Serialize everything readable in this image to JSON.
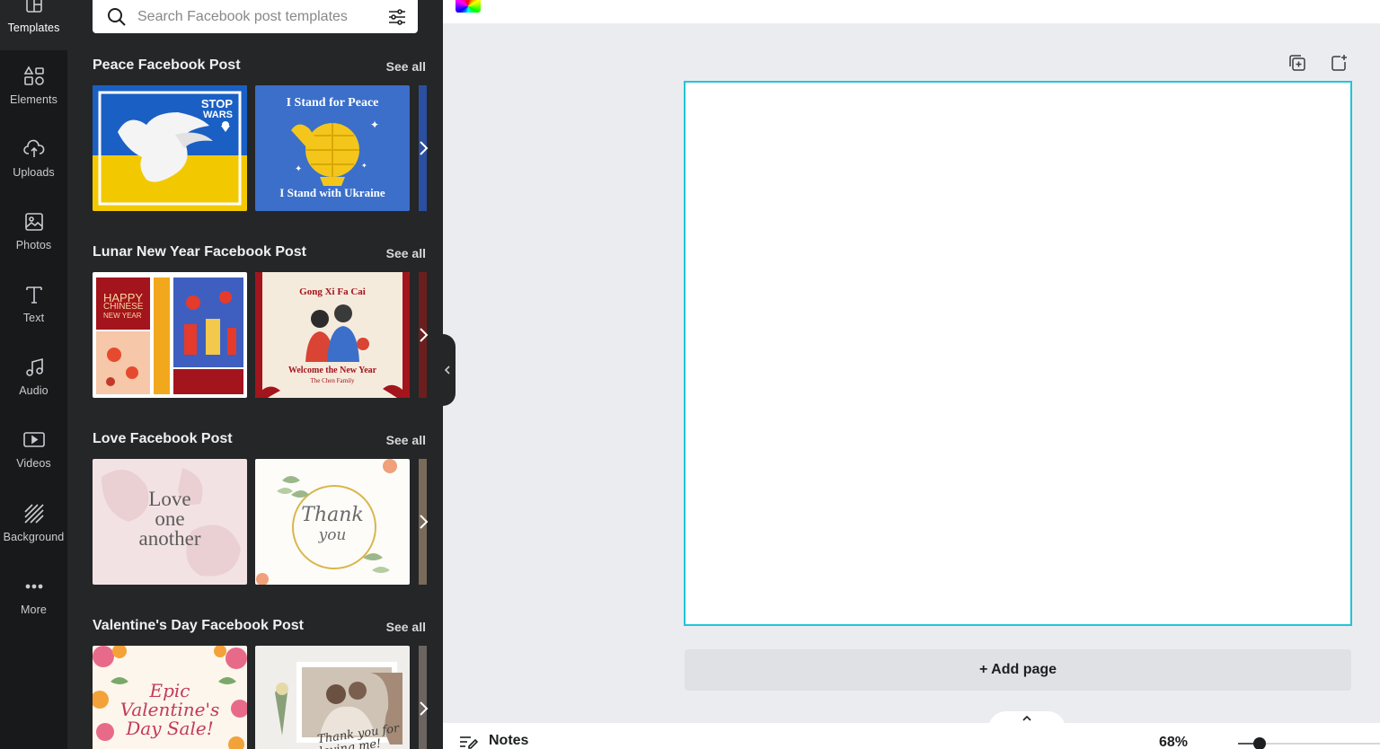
{
  "rail": {
    "items": [
      {
        "label": "Templates",
        "icon": "templates-icon"
      },
      {
        "label": "Elements",
        "icon": "elements-icon"
      },
      {
        "label": "Uploads",
        "icon": "upload-cloud-icon"
      },
      {
        "label": "Photos",
        "icon": "photo-icon"
      },
      {
        "label": "Text",
        "icon": "text-icon"
      },
      {
        "label": "Audio",
        "icon": "music-note-icon"
      },
      {
        "label": "Videos",
        "icon": "video-icon"
      },
      {
        "label": "Background",
        "icon": "background-pattern-icon"
      },
      {
        "label": "More",
        "icon": "more-dots-icon"
      }
    ]
  },
  "search": {
    "placeholder": "Search Facebook post templates"
  },
  "sections": [
    {
      "title": "Peace Facebook Post",
      "see_all": "See all",
      "thumb1_text": [
        "STOP",
        "WARS"
      ],
      "thumb2_text": [
        "I Stand for Peace",
        "I Stand with Ukraine"
      ]
    },
    {
      "title": "Lunar New Year Facebook Post",
      "see_all": "See all",
      "thumb1_text": [
        "HAPPY",
        "CHINESE",
        "NEW YEAR"
      ],
      "thumb2_text": [
        "Gong Xi Fa Cai",
        "Welcome the New Year",
        "The Chen Family"
      ]
    },
    {
      "title": "Love Facebook Post",
      "see_all": "See all",
      "thumb1_text": [
        "Love",
        "one",
        "another"
      ],
      "thumb2_text": [
        "Thank",
        "you"
      ]
    },
    {
      "title": "Valentine's Day Facebook Post",
      "see_all": "See all",
      "thumb1_text": [
        "Epic",
        "Valentine's",
        "Day Sale!"
      ],
      "thumb2_text": [
        "Thank you for",
        "loving me!"
      ]
    }
  ],
  "editor": {
    "add_page_label": "+ Add page"
  },
  "footer": {
    "notes_label": "Notes",
    "zoom_label": "68%",
    "zoom_level": 0.15
  },
  "colors": {
    "accent": "#22c5d6",
    "rail_bg": "#18191b",
    "panel_bg": "#252627"
  }
}
